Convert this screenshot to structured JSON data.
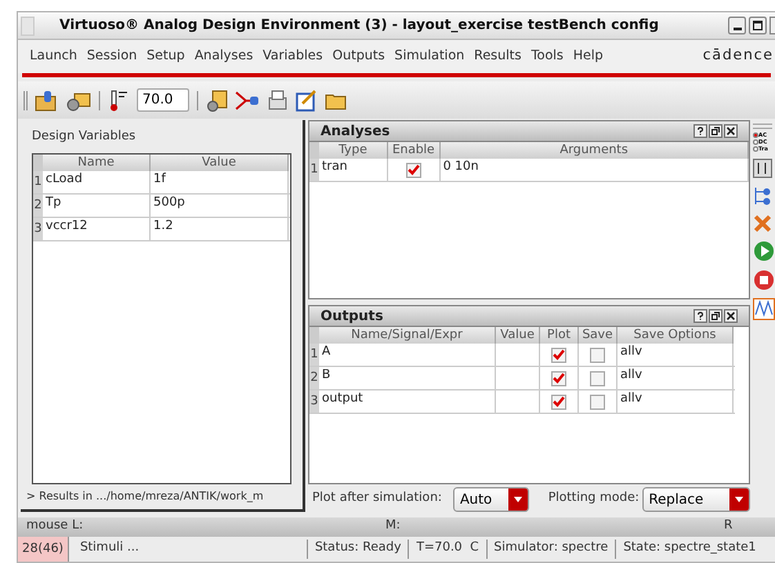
{
  "window": {
    "title": "Virtuoso® Analog Design Environment (3) - layout_exercise testBench config"
  },
  "menu": [
    "Launch",
    "Session",
    "Setup",
    "Analyses",
    "Variables",
    "Outputs",
    "Simulation",
    "Results",
    "Tools",
    "Help"
  ],
  "logo": "cādence",
  "toolbar": {
    "temperature": "70.0"
  },
  "design_variables": {
    "title": "Design Variables",
    "columns": [
      "Name",
      "Value"
    ],
    "rows": [
      {
        "index": "1",
        "name": "cLoad",
        "value": "1f"
      },
      {
        "index": "2",
        "name": "Tp",
        "value": "500p"
      },
      {
        "index": "3",
        "name": "vccr12",
        "value": "1.2"
      }
    ],
    "results_path": "> Results in .../home/mreza/ANTIK/work_m"
  },
  "analyses": {
    "title": "Analyses",
    "columns": [
      "Type",
      "Enable",
      "Arguments"
    ],
    "rows": [
      {
        "index": "1",
        "type": "tran",
        "enabled": true,
        "arguments": "0 10n"
      }
    ]
  },
  "outputs": {
    "title": "Outputs",
    "columns": [
      "Name/Signal/Expr",
      "Value",
      "Plot",
      "Save",
      "Save Options"
    ],
    "rows": [
      {
        "index": "1",
        "name": "A",
        "plot": true,
        "save": false,
        "save_options": "allv"
      },
      {
        "index": "2",
        "name": "B",
        "plot": true,
        "save": false,
        "save_options": "allv"
      },
      {
        "index": "3",
        "name": "output",
        "plot": true,
        "save": false,
        "save_options": "allv"
      }
    ]
  },
  "side_radios": [
    {
      "label": "AC",
      "selected": true
    },
    {
      "label": "DC",
      "selected": false
    },
    {
      "label": "Tra",
      "selected": false
    }
  ],
  "plot_after": {
    "label": "Plot after simulation:",
    "value": "Auto"
  },
  "plotting_mode": {
    "label": "Plotting mode:",
    "value": "Replace"
  },
  "mouse_bar": {
    "left": "mouse L:",
    "middle": "M:",
    "right": "R"
  },
  "status_bar": {
    "count": "28(46)",
    "message": "Stimuli ...",
    "status": "Status: Ready",
    "temp": "T=70.0  C",
    "simulator": "Simulator: spectre",
    "state": "State: spectre_state1"
  }
}
